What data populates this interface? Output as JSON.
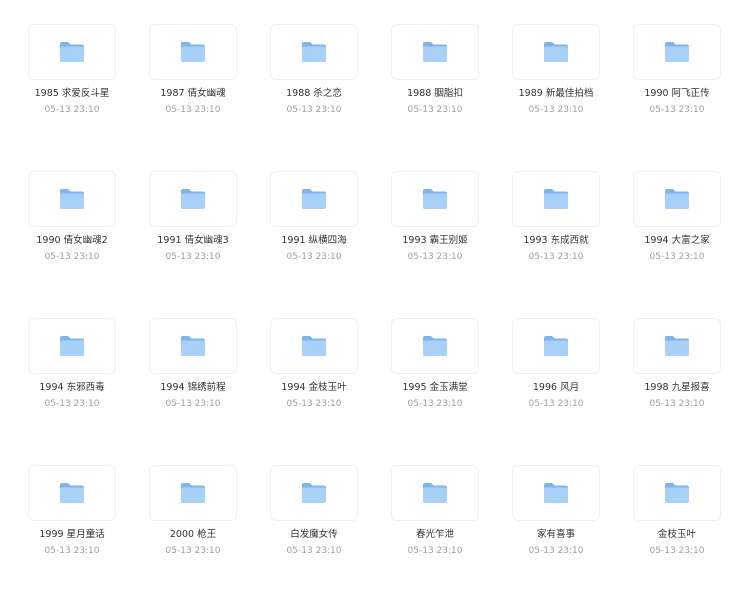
{
  "files": [
    {
      "name": "1985 求爱反斗星",
      "date": "05-13 23:10"
    },
    {
      "name": "1987 倩女幽魂",
      "date": "05-13 23:10"
    },
    {
      "name": "1988 杀之恋",
      "date": "05-13 23:10"
    },
    {
      "name": "1988 胭脂扣",
      "date": "05-13 23:10"
    },
    {
      "name": "1989 新最佳拍档",
      "date": "05-13 23:10"
    },
    {
      "name": "1990 阿飞正传",
      "date": "05-13 23:10"
    },
    {
      "name": "1990 倩女幽魂2",
      "date": "05-13 23:10"
    },
    {
      "name": "1991 倩女幽魂3",
      "date": "05-13 23:10"
    },
    {
      "name": "1991 纵横四海",
      "date": "05-13 23:10"
    },
    {
      "name": "1993 霸王别姬",
      "date": "05-13 23:10"
    },
    {
      "name": "1993 东成西就",
      "date": "05-13 23:10"
    },
    {
      "name": "1994 大富之家",
      "date": "05-13 23:10"
    },
    {
      "name": "1994 东邪西毒",
      "date": "05-13 23:10"
    },
    {
      "name": "1994 锦绣前程",
      "date": "05-13 23:10"
    },
    {
      "name": "1994 金枝玉叶",
      "date": "05-13 23:10"
    },
    {
      "name": "1995 金玉满堂",
      "date": "05-13 23:10"
    },
    {
      "name": "1996 风月",
      "date": "05-13 23:10"
    },
    {
      "name": "1998 九星报喜",
      "date": "05-13 23:10"
    },
    {
      "name": "1999 星月童话",
      "date": "05-13 23:10"
    },
    {
      "name": "2000 枪王",
      "date": "05-13 23:10"
    },
    {
      "name": "白发魔女传",
      "date": "05-13 23:10"
    },
    {
      "name": "春光乍泄",
      "date": "05-13 23:10"
    },
    {
      "name": "家有喜事",
      "date": "05-13 23:10"
    },
    {
      "name": "金枝玉叶",
      "date": "05-13 23:10"
    }
  ],
  "icons": {
    "folder": "folder-icon"
  },
  "colors": {
    "folder_back": "#7fb5ee",
    "folder_front": "#a9d1f8",
    "name_text": "#333333",
    "date_text": "#9aa0a6"
  }
}
